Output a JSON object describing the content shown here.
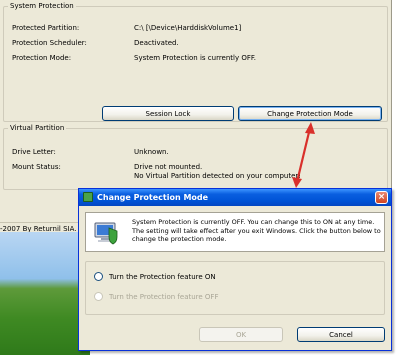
{
  "main": {
    "system_protection": {
      "legend": "System Protection",
      "rows": [
        {
          "label": "Protected Partition:",
          "value": "C:\\    [\\Device\\HarddiskVolume1]"
        },
        {
          "label": "Protection Scheduler:",
          "value": "Deactivated."
        },
        {
          "label": "Protection Mode:",
          "value": "System Protection is currently OFF."
        }
      ],
      "buttons": {
        "session_lock": "Session Lock",
        "change_mode": "Change Protection Mode"
      }
    },
    "virtual_partition": {
      "legend": "Virtual Partition",
      "rows": [
        {
          "label": "Drive Letter:",
          "value": "Unknown."
        },
        {
          "label": "Mount Status:",
          "value": "Drive not mounted."
        },
        {
          "label": "",
          "value": "No Virtual Partition detected on your computer!"
        }
      ]
    }
  },
  "taskbar": {
    "copyright": "-2007 By Returnil SIA."
  },
  "dialog": {
    "title": "Change Protection Mode",
    "close": "×",
    "info_lines": [
      "System Protection is currently OFF. You can change this to ON at any time.",
      "The setting will take effect after you exit Windows. Click the button below to",
      "change the protection mode."
    ],
    "options": [
      {
        "label": "Turn the Protection feature ON",
        "enabled": true
      },
      {
        "label": "Turn the Protection feature OFF",
        "enabled": false
      }
    ],
    "ok_label": "OK",
    "cancel_label": "Cancel"
  },
  "colors": {
    "annotation_arrow": "#d9302b",
    "titlebar": "#0053d6"
  }
}
